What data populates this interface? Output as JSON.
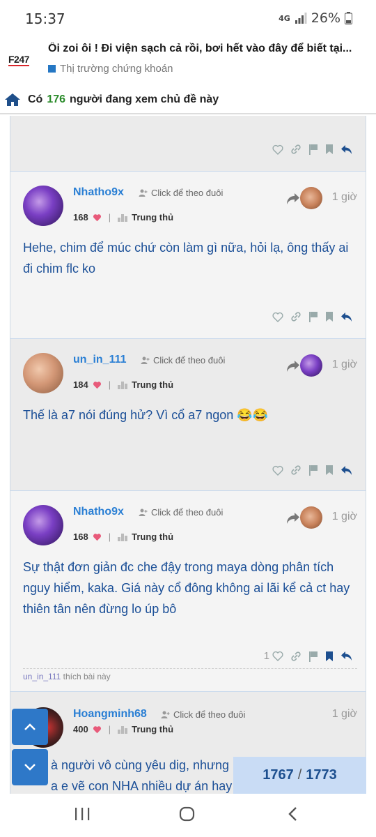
{
  "status": {
    "time": "15:37",
    "network": "4G",
    "battery": "26%"
  },
  "header": {
    "logo_text": "F247",
    "thread_title": "Ối zoi ôi ! Đi viện sạch cả rồi, bơi hết vào đây để biết tại...",
    "forum": "Thị trường chứng khoán"
  },
  "viewers": {
    "prefix": "Có",
    "count": "176",
    "suffix": "người đang xem chủ đề này"
  },
  "posts": [
    {
      "username": "Nhatho9x",
      "follow": "Click để theo đuôi",
      "points": "168",
      "title": "Trung thủ",
      "time": "1 giờ",
      "content": "Hehe, chim để múc chứ còn làm gì nữa, hỏi lạ, ông thấy ai đi chim flc ko"
    },
    {
      "username": "un_in_111",
      "follow": "Click để theo đuôi",
      "points": "184",
      "title": "Trung thủ",
      "time": "1 giờ",
      "content": "Thế là a7 nói đúng hử? Vì cổ a7 ngon 😂😂"
    },
    {
      "username": "Nhatho9x",
      "follow": "Click để theo đuôi",
      "points": "168",
      "title": "Trung thủ",
      "time": "1 giờ",
      "content": "Sự thật đơn giản đc che đậy trong maya dòng phân tích nguy hiểm, kaka. Giá này cổ đông không ai lãi kể cả ct hay thiên tân nên đừng lo úp bô",
      "like_count": "1",
      "liked_by_user": "un_in_111",
      "liked_by_suffix": "thích bài này"
    },
    {
      "username": "Hoangminh68",
      "follow": "Click để theo đuôi",
      "points": "400",
      "title": "Trung thủ",
      "time": "1 giờ",
      "content_line1": "à người vô cùng yêu dig, nhưng r",
      "content_line2": "a e vẽ con NHA nhiều dự án hay nhiề"
    }
  ],
  "pager": {
    "current": "1767",
    "total": "1773"
  },
  "colors": {
    "accent": "#2a7fd4",
    "content_text": "#1b4f97",
    "viewer_count": "#2a8b2a",
    "fab": "#2e78c8",
    "pager_bg": "#c9dcf5"
  }
}
